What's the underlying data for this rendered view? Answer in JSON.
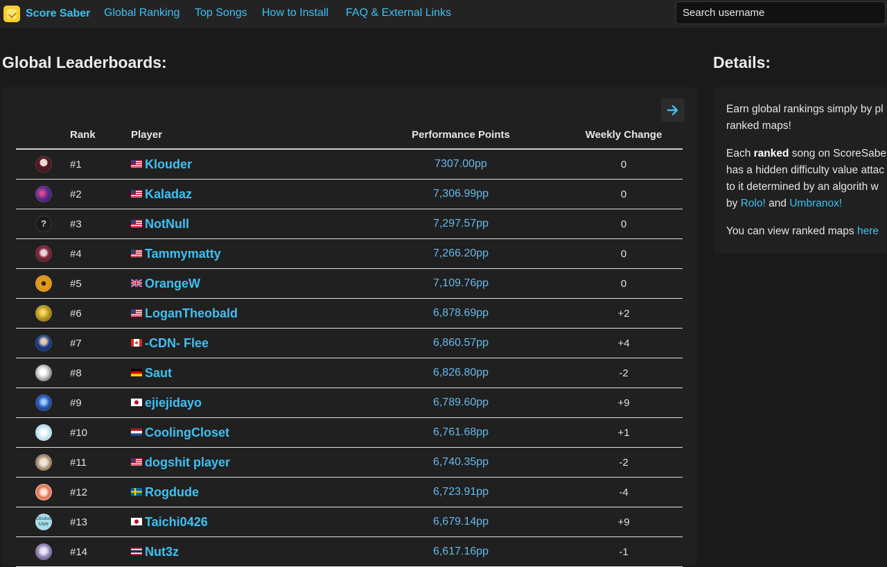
{
  "nav": {
    "brand": "Score Saber",
    "links": [
      "Global Ranking",
      "Top Songs",
      "How to Install",
      "FAQ & External Links"
    ],
    "search_placeholder": "Search username"
  },
  "leaderboard": {
    "title": "Global Leaderboards:",
    "next_icon": "arrow-right-icon",
    "headers": {
      "rank": "Rank",
      "player": "Player",
      "pp": "Performance Points",
      "weekly": "Weekly Change"
    },
    "rows": [
      {
        "rank": "#1",
        "country": "us",
        "player": "Klouder",
        "pp": "7307.00pp",
        "weekly_change": "0"
      },
      {
        "rank": "#2",
        "country": "us",
        "player": "Kaladaz",
        "pp": "7,306.99pp",
        "weekly_change": "0"
      },
      {
        "rank": "#3",
        "country": "us",
        "player": "NotNull",
        "pp": "7,297.57pp",
        "weekly_change": "0"
      },
      {
        "rank": "#4",
        "country": "us",
        "player": "Tammymatty",
        "pp": "7,266.20pp",
        "weekly_change": "0"
      },
      {
        "rank": "#5",
        "country": "gb",
        "player": "OrangeW",
        "pp": "7,109.76pp",
        "weekly_change": "0"
      },
      {
        "rank": "#6",
        "country": "us",
        "player": "LoganTheobald",
        "pp": "6,878.69pp",
        "weekly_change": "+2"
      },
      {
        "rank": "#7",
        "country": "ca",
        "player": "-CDN- Flee",
        "pp": "6,860.57pp",
        "weekly_change": "+4"
      },
      {
        "rank": "#8",
        "country": "de",
        "player": "Saut",
        "pp": "6,826.80pp",
        "weekly_change": "-2"
      },
      {
        "rank": "#9",
        "country": "jp",
        "player": "ejiejidayo",
        "pp": "6,789.60pp",
        "weekly_change": "+9"
      },
      {
        "rank": "#10",
        "country": "nl",
        "player": "CoolingCloset",
        "pp": "6,761.68pp",
        "weekly_change": "+1"
      },
      {
        "rank": "#11",
        "country": "us",
        "player": "dogshit player",
        "pp": "6,740.35pp",
        "weekly_change": "-2"
      },
      {
        "rank": "#12",
        "country": "se",
        "player": "Rogdude",
        "pp": "6,723.91pp",
        "weekly_change": "-4"
      },
      {
        "rank": "#13",
        "country": "jp",
        "player": "Taichi0426",
        "pp": "6,679.14pp",
        "weekly_change": "+9"
      },
      {
        "rank": "#14",
        "country": "th",
        "player": "Nut3z",
        "pp": "6,617.16pp",
        "weekly_change": "-1"
      }
    ]
  },
  "details": {
    "title": "Details:",
    "p1": "Earn global rankings simply by pl",
    "p1b": "ranked maps!",
    "p2_pre": "Each ",
    "p2_bold": "ranked",
    "p2_post": " song on ScoreSaber",
    "p2b": "has a hidden difficulty value attac",
    "p2c": "to it determined by an algorith w",
    "p2d_pre": "by ",
    "link_rolo": "Rolo!",
    "p2d_mid": " and ",
    "link_umbranox": "Umbranox!",
    "p3_pre": "You can view ranked maps ",
    "link_here": "here"
  }
}
